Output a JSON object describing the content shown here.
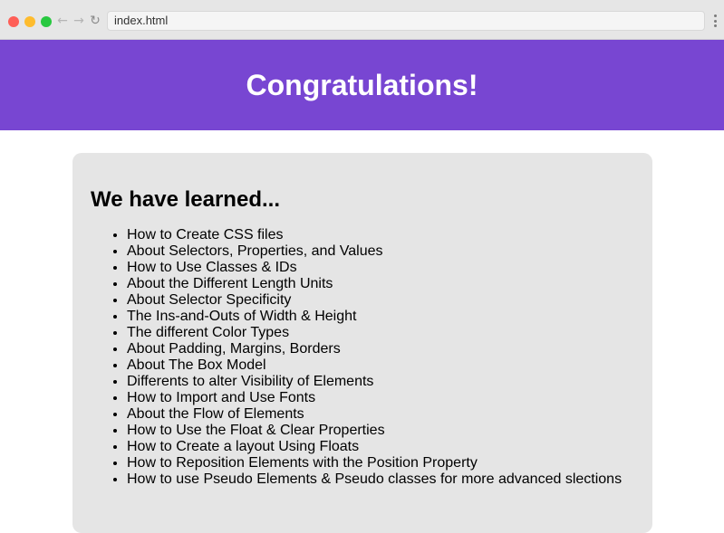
{
  "browser": {
    "address": "index.html",
    "back_glyph": "←",
    "forward_glyph": "→",
    "reload_glyph": "↻",
    "colors": {
      "close": "#fe5f57",
      "minimize": "#febc2e",
      "maximize": "#28c840"
    }
  },
  "header": {
    "title": "Congratulations!",
    "background": "#7846d2"
  },
  "card": {
    "heading": "We have learned...",
    "items": [
      "How to Create CSS files",
      "About Selectors, Properties, and Values",
      "How to Use Classes & IDs",
      "About the Different Length Units",
      "About Selector Specificity",
      "The Ins-and-Outs of Width & Height",
      "The different Color Types",
      "About Padding, Margins, Borders",
      "About The Box Model",
      "Differents to alter Visibility of Elements",
      "How to Import and Use Fonts",
      "About the Flow of Elements",
      "How to Use the Float & Clear Properties",
      "How to Create a layout Using Floats",
      "How to Reposition Elements with the Position Property",
      "How to use Pseudo Elements & Pseudo classes for more advanced slections"
    ]
  }
}
